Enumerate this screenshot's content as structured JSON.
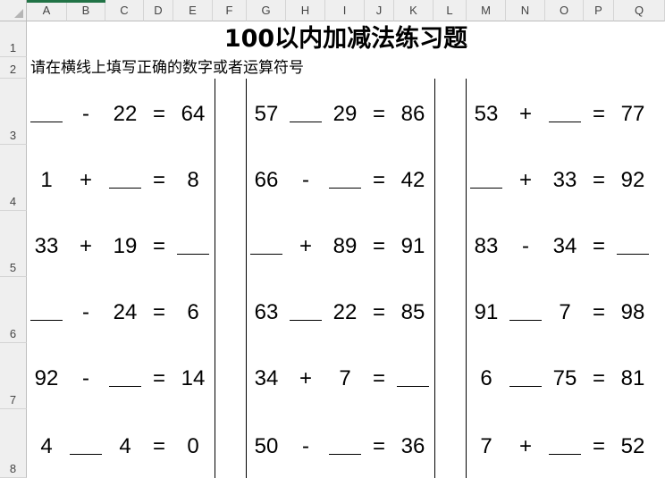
{
  "columns": [
    "A",
    "B",
    "C",
    "D",
    "E",
    "F",
    "G",
    "H",
    "I",
    "J",
    "K",
    "L",
    "M",
    "N",
    "O",
    "P",
    "Q"
  ],
  "rows": [
    "1",
    "2",
    "3",
    "4",
    "5",
    "6",
    "7",
    "8"
  ],
  "title": "100以内加减法练习题",
  "subtitle": "请在横线上填写正确的数字或者运算符号",
  "groups": [
    [
      {
        "a": "",
        "op": "-",
        "b": "22",
        "eq": "=",
        "r": "64"
      },
      {
        "a": "1",
        "op": "+",
        "b": "",
        "eq": "=",
        "r": "8"
      },
      {
        "a": "33",
        "op": "+",
        "b": "19",
        "eq": "=",
        "r": ""
      },
      {
        "a": "",
        "op": "-",
        "b": "24",
        "eq": "=",
        "r": "6"
      },
      {
        "a": "92",
        "op": "-",
        "b": "",
        "eq": "=",
        "r": "14"
      },
      {
        "a": "4",
        "op": "",
        "b": "4",
        "eq": "=",
        "r": "0"
      }
    ],
    [
      {
        "a": "57",
        "op": "",
        "b": "29",
        "eq": "=",
        "r": "86"
      },
      {
        "a": "66",
        "op": "-",
        "b": "",
        "eq": "=",
        "r": "42"
      },
      {
        "a": "",
        "op": "+",
        "b": "89",
        "eq": "=",
        "r": "91"
      },
      {
        "a": "63",
        "op": "",
        "b": "22",
        "eq": "=",
        "r": "85"
      },
      {
        "a": "34",
        "op": "+",
        "b": "7",
        "eq": "=",
        "r": ""
      },
      {
        "a": "50",
        "op": "-",
        "b": "",
        "eq": "=",
        "r": "36"
      }
    ],
    [
      {
        "a": "53",
        "op": "+",
        "b": "",
        "eq": "=",
        "r": "77"
      },
      {
        "a": "",
        "op": "+",
        "b": "33",
        "eq": "=",
        "r": "92"
      },
      {
        "a": "83",
        "op": "-",
        "b": "34",
        "eq": "=",
        "r": ""
      },
      {
        "a": "91",
        "op": "",
        "b": "7",
        "eq": "=",
        "r": "98"
      },
      {
        "a": "6",
        "op": "",
        "b": "75",
        "eq": "=",
        "r": "81"
      },
      {
        "a": "7",
        "op": "+",
        "b": "",
        "eq": "=",
        "r": "52"
      }
    ]
  ]
}
